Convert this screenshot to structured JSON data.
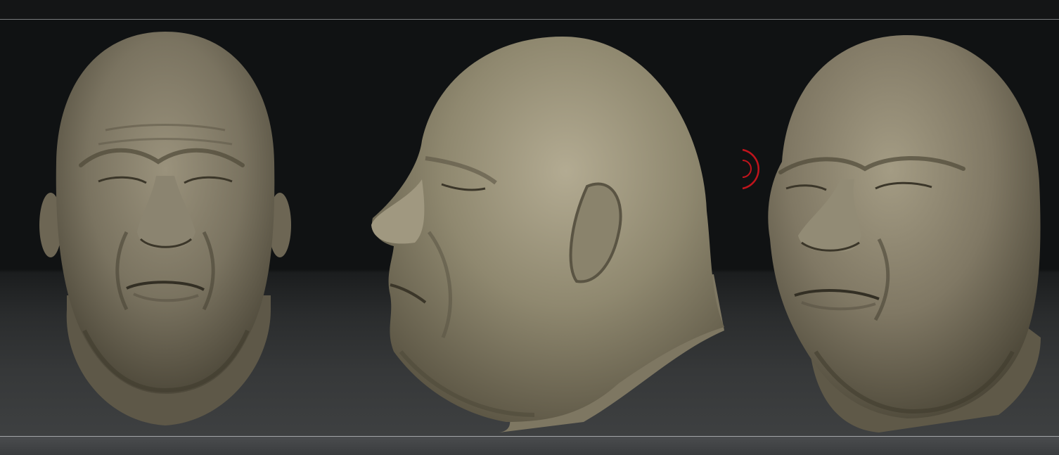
{
  "app": {
    "name": "",
    "canvas_background": "#111213",
    "clay_color": "#7a7360",
    "cursor_color": "#c0141c"
  },
  "views": [
    {
      "name": "front-view",
      "model": "sculpted-head"
    },
    {
      "name": "side-view",
      "model": "sculpted-head"
    },
    {
      "name": "three-quarter-view",
      "model": "sculpted-head"
    }
  ]
}
